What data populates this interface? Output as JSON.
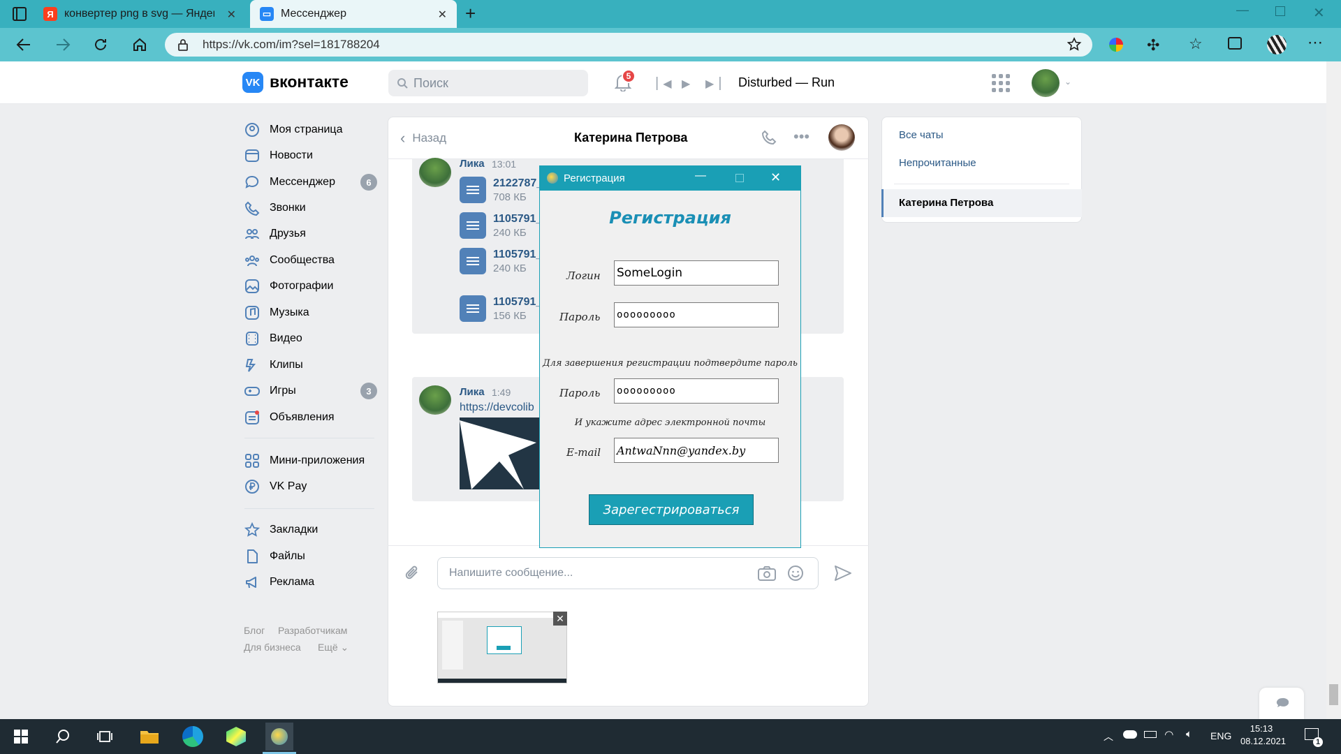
{
  "browser": {
    "tabs": [
      {
        "title": "конвертер png в svg — Яндекс",
        "icon": "yandex-icon"
      },
      {
        "title": "Мессенджер",
        "icon": "vk-messenger-icon"
      }
    ],
    "url": "https://vk.com/im?sel=181788204"
  },
  "vk": {
    "logo_text": "вконтакте",
    "search_placeholder": "Поиск",
    "notifications_count": "5",
    "now_playing": "Disturbed — Run",
    "menu": [
      {
        "label": "Моя страница",
        "icon": "profile-icon"
      },
      {
        "label": "Новости",
        "icon": "news-icon"
      },
      {
        "label": "Мессенджер",
        "icon": "messenger-icon",
        "badge": "6"
      },
      {
        "label": "Звонки",
        "icon": "phone-icon"
      },
      {
        "label": "Друзья",
        "icon": "friends-icon"
      },
      {
        "label": "Сообщества",
        "icon": "communities-icon"
      },
      {
        "label": "Фотографии",
        "icon": "photos-icon"
      },
      {
        "label": "Музыка",
        "icon": "music-icon"
      },
      {
        "label": "Видео",
        "icon": "video-icon"
      },
      {
        "label": "Клипы",
        "icon": "clips-icon"
      },
      {
        "label": "Игры",
        "icon": "games-icon",
        "badge": "3"
      },
      {
        "label": "Объявления",
        "icon": "ads-icon"
      },
      {
        "label": "Мини-приложения",
        "icon": "apps-icon"
      },
      {
        "label": "VK Pay",
        "icon": "vkpay-icon"
      },
      {
        "label": "Закладки",
        "icon": "bookmarks-icon"
      },
      {
        "label": "Файлы",
        "icon": "files-icon"
      },
      {
        "label": "Реклама",
        "icon": "advert-icon"
      }
    ],
    "footer_links": [
      "Блог",
      "Разработчикам",
      "Для бизнеса",
      "Ещё"
    ],
    "chat": {
      "back_label": "Назад",
      "title": "Катерина Петрова",
      "msg1": {
        "author": "Лика",
        "time": "13:01",
        "files": [
          {
            "name": "2122787_",
            "size": "708 КБ"
          },
          {
            "name": "1105791_",
            "size": "240 КБ"
          },
          {
            "name": "1105791_",
            "size": "240 КБ"
          },
          {
            "name": "1105791_",
            "size": "156 КБ"
          }
        ]
      },
      "msg2": {
        "author": "Лика",
        "time": "1:49",
        "link": "https://devcolib"
      },
      "input_placeholder": "Напишите сообщение..."
    },
    "right_panel": {
      "all_chats": "Все чаты",
      "unread": "Непрочитанные",
      "selected_chat": "Катерина Петрова"
    }
  },
  "dialog": {
    "window_title": "Регистрация",
    "heading": "Регистрация",
    "login_label": "Логин",
    "login_value": "SomeLogin",
    "password_label": "Пароль",
    "password_value": "ooooooooo",
    "confirm_note": "Для завершения регистрации подтвердите пароль",
    "password2_label": "Пароль",
    "password2_value": "ooooooooo",
    "email_note": "И укажите адрес электронной почты",
    "email_label": "E-mail",
    "email_value": "AntwaNnn@yandex.by",
    "submit_label": "Зарегестрироваться"
  },
  "taskbar": {
    "lang": "ENG",
    "time": "15:13",
    "date": "08.12.2021",
    "notification_count": "1"
  },
  "colors": {
    "vk_blue": "#2787f5",
    "dialog_accent": "#1a9fb5",
    "browser_frame": "#38b0be"
  }
}
